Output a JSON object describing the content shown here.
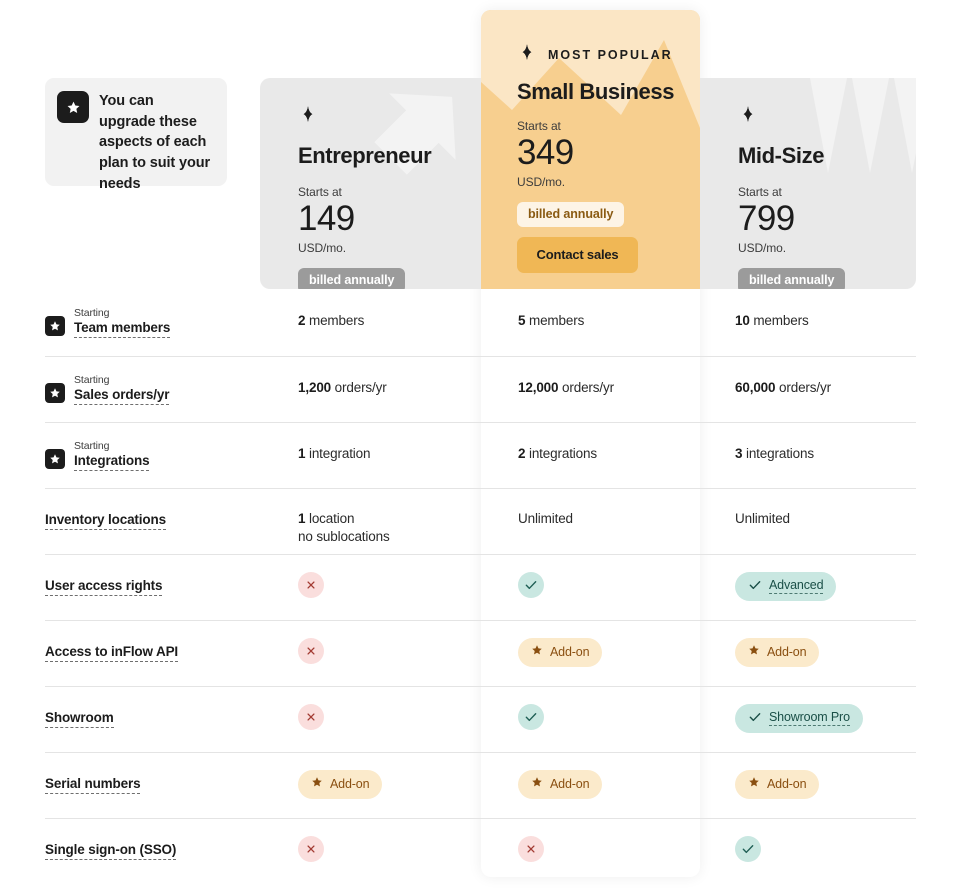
{
  "callout": {
    "icon": "star-icon",
    "text": "You can upgrade these aspects of each plan to suit your needs"
  },
  "plans": [
    {
      "id": "entrepreneur",
      "spark_icon": "sparkle-icon",
      "name": "Entrepreneur",
      "starts_at_label": "Starts at",
      "price": "149",
      "currency_period": "USD/mo.",
      "billing_badge": "billed annually",
      "featured": false,
      "cta": null,
      "ribbon": null,
      "bg_color": "#e9e9e9"
    },
    {
      "id": "small-business",
      "spark_icon": "sparkle-icon",
      "name": "Small Business",
      "starts_at_label": "Starts at",
      "price": "349",
      "currency_period": "USD/mo.",
      "billing_badge": "billed annually",
      "featured": true,
      "cta": "Contact sales",
      "ribbon": "MOST POPULAR",
      "bg_color": "#f7cf8f"
    },
    {
      "id": "mid-size",
      "spark_icon": "sparkle-icon",
      "name": "Mid-Size",
      "starts_at_label": "Starts at",
      "price": "799",
      "currency_period": "USD/mo.",
      "billing_badge": "billed annually",
      "featured": false,
      "cta": null,
      "ribbon": null,
      "bg_color": "#e9e9e9"
    }
  ],
  "features": [
    {
      "id": "team-members",
      "upgradable": true,
      "starting_label": "Starting",
      "label": "Team members",
      "values": [
        {
          "type": "number",
          "num": "2",
          "unit": "members"
        },
        {
          "type": "number",
          "num": "5",
          "unit": "members"
        },
        {
          "type": "number",
          "num": "10",
          "unit": "members"
        }
      ]
    },
    {
      "id": "sales-orders",
      "upgradable": true,
      "starting_label": "Starting",
      "label": "Sales orders/yr",
      "values": [
        {
          "type": "number",
          "num": "1,200",
          "unit": "orders/yr"
        },
        {
          "type": "number",
          "num": "12,000",
          "unit": "orders/yr"
        },
        {
          "type": "number",
          "num": "60,000",
          "unit": "orders/yr"
        }
      ]
    },
    {
      "id": "integrations",
      "upgradable": true,
      "starting_label": "Starting",
      "label": "Integrations",
      "values": [
        {
          "type": "number",
          "num": "1",
          "unit": "integration"
        },
        {
          "type": "number",
          "num": "2",
          "unit": "integrations"
        },
        {
          "type": "number",
          "num": "3",
          "unit": "integrations"
        }
      ]
    },
    {
      "id": "inventory-locations",
      "upgradable": false,
      "starting_label": null,
      "label": "Inventory locations",
      "values": [
        {
          "type": "number",
          "num": "1",
          "unit": "location",
          "line2": "no sublocations"
        },
        {
          "type": "text",
          "text": "Unlimited"
        },
        {
          "type": "text",
          "text": "Unlimited"
        }
      ]
    },
    {
      "id": "user-access-rights",
      "upgradable": false,
      "starting_label": null,
      "label": "User access rights",
      "values": [
        {
          "type": "no",
          "icon": "cross-icon"
        },
        {
          "type": "yes",
          "icon": "check-icon"
        },
        {
          "type": "pill-teal",
          "icon": "check-icon",
          "text": "Advanced"
        }
      ]
    },
    {
      "id": "inflow-api",
      "upgradable": false,
      "starting_label": null,
      "label": "Access to inFlow API",
      "values": [
        {
          "type": "no",
          "icon": "cross-icon"
        },
        {
          "type": "pill-addon",
          "icon": "star-icon",
          "text": "Add-on"
        },
        {
          "type": "pill-addon",
          "icon": "star-icon",
          "text": "Add-on"
        }
      ]
    },
    {
      "id": "showroom",
      "upgradable": false,
      "starting_label": null,
      "label": "Showroom",
      "values": [
        {
          "type": "no",
          "icon": "cross-icon"
        },
        {
          "type": "yes",
          "icon": "check-icon"
        },
        {
          "type": "pill-teal",
          "icon": "check-icon",
          "text": "Showroom Pro"
        }
      ]
    },
    {
      "id": "serial-numbers",
      "upgradable": false,
      "starting_label": null,
      "label": "Serial numbers",
      "values": [
        {
          "type": "pill-addon",
          "icon": "star-icon",
          "text": "Add-on"
        },
        {
          "type": "pill-addon",
          "icon": "star-icon",
          "text": "Add-on"
        },
        {
          "type": "pill-addon",
          "icon": "star-icon",
          "text": "Add-on"
        }
      ]
    },
    {
      "id": "sso",
      "upgradable": false,
      "starting_label": null,
      "label": "Single sign-on (SSO)",
      "values": [
        {
          "type": "no",
          "icon": "cross-icon"
        },
        {
          "type": "no",
          "icon": "cross-icon"
        },
        {
          "type": "yes",
          "icon": "check-icon"
        }
      ]
    }
  ],
  "colors": {
    "featured_accent": "#f7cf8f",
    "cta": "#f0b755",
    "header_band": "#e9e9e9",
    "yes": "#c9e7e1",
    "no": "#fadedd",
    "addon": "#fbeacb"
  }
}
